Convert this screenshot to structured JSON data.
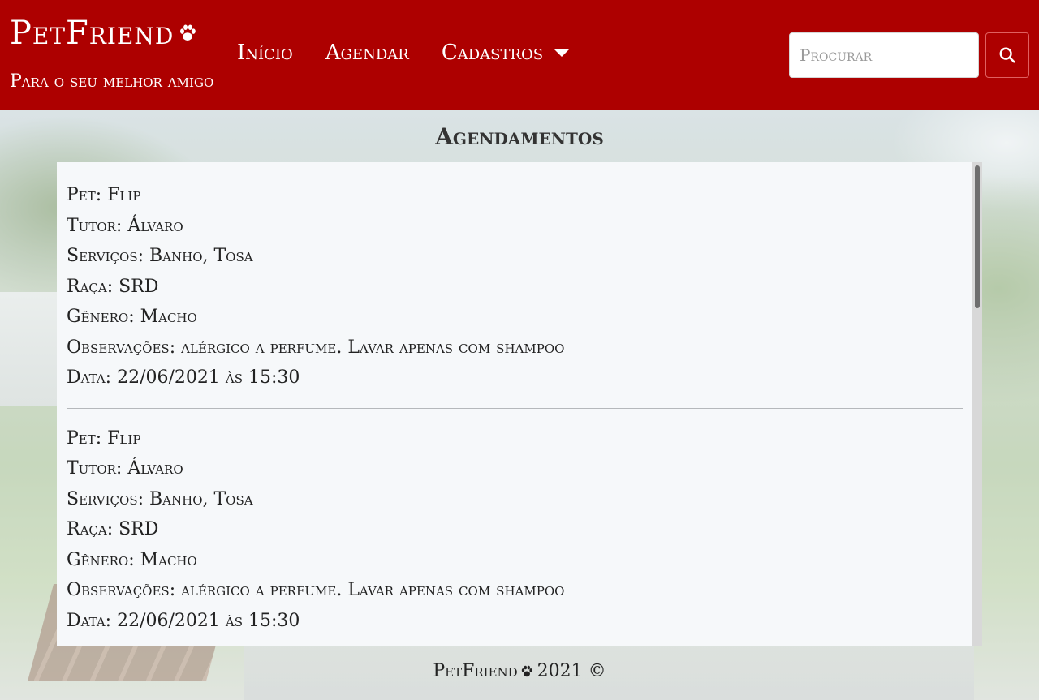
{
  "brand": {
    "title": "PetFriend",
    "subtitle": "Para o seu melhor amigo",
    "icon": "paw-icon"
  },
  "nav": {
    "items": [
      {
        "label": "Início"
      },
      {
        "label": "Agendar"
      },
      {
        "label": "Cadastros"
      }
    ]
  },
  "search": {
    "placeholder": "Procurar",
    "value": "",
    "icon": "search-icon"
  },
  "main": {
    "title": "Agendamentos",
    "entries": [
      {
        "pet": "Pet: Flip",
        "tutor": "Tutor: Álvaro",
        "servicos": "Serviços: Banho, Tosa",
        "raca": "Raça: SRD",
        "genero": "Gênero: Macho",
        "observacoes": "Observações: alérgico a perfume. Lavar apenas com shampoo",
        "data": "Data: 22/06/2021 às 15:30"
      },
      {
        "pet": "Pet: Flip",
        "tutor": "Tutor: Álvaro",
        "servicos": "Serviços: Banho, Tosa",
        "raca": "Raça: SRD",
        "genero": "Gênero: Macho",
        "observacoes": "Observações: alérgico a perfume. Lavar apenas com shampoo",
        "data": "Data: 22/06/2021 às 15:30"
      }
    ]
  },
  "footer": {
    "brand": "PetFriend",
    "text": "2021 ©"
  },
  "colors": {
    "navbar": "#ad0000",
    "panel": "#f6f8fa"
  }
}
